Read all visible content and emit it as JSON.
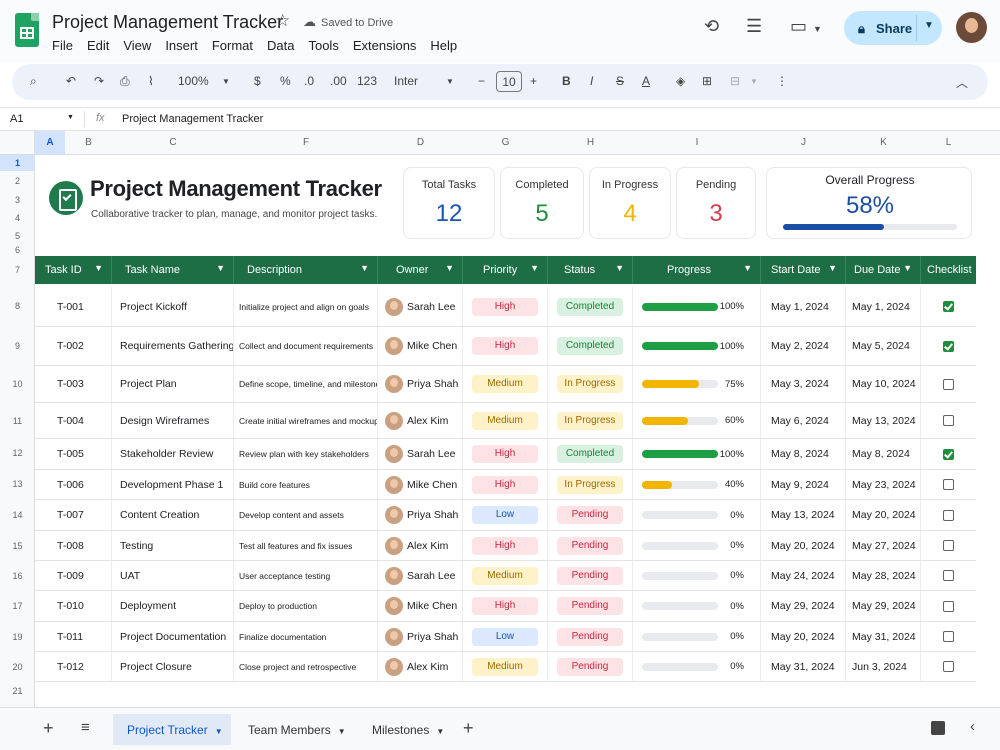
{
  "app": {
    "doc_title": "Project Management Tracker",
    "saved_status": "Saved to Drive",
    "menus": [
      "File",
      "Edit",
      "View",
      "Insert",
      "Format",
      "Data",
      "Tools",
      "Extensions",
      "Help"
    ],
    "share_label": "Share"
  },
  "toolbar": {
    "zoom": "100%",
    "currency": "$",
    "percent": "%",
    "dec_dec": ".0",
    "dec_inc": ".00",
    "number_fmt": "123",
    "font": "Inter",
    "font_size": "10",
    "minus": "−",
    "plus": "+",
    "bold": "B",
    "italic": "I",
    "strike": "S",
    "text_color": "A"
  },
  "formula_bar": {
    "cell_ref": "A1",
    "fx": "fx",
    "value": "Project Management Tracker"
  },
  "columns": [
    "A",
    "B",
    "C",
    "F",
    "D",
    "G",
    "H",
    "I",
    "J",
    "K",
    "L"
  ],
  "row_numbers": [
    "1",
    "2",
    "3",
    "4",
    "5",
    "6",
    "7",
    "8",
    "9",
    "10",
    "11",
    "12",
    "13",
    "14",
    "15",
    "16",
    "17",
    "19",
    "20",
    "21"
  ],
  "header": {
    "title": "Project Management Tracker",
    "subtitle": "Collaborative tracker to plan, manage, and monitor project tasks."
  },
  "summary": {
    "total": {
      "label": "Total Tasks",
      "value": "12",
      "color": "#1a56b5"
    },
    "completed": {
      "label": "Completed",
      "value": "5",
      "color": "#1e8e3e"
    },
    "in_progress": {
      "label": "In Progress",
      "value": "4",
      "color": "#f2b600"
    },
    "pending": {
      "label": "Pending",
      "value": "3",
      "color": "#d93b4a"
    },
    "overall": {
      "label": "Overall Progress",
      "value": "58%",
      "fraction": 0.58
    }
  },
  "table": {
    "headers": [
      "Task ID",
      "Task Name",
      "Description",
      "Owner",
      "Priority",
      "Status",
      "Progress",
      "Start Date",
      "Due Date",
      "Checklist"
    ],
    "rows": [
      {
        "id": "T-001",
        "name": "Project Kickoff",
        "desc": "Initialize project and align on goals",
        "owner": "Sarah Lee",
        "priority": "High",
        "status": "Completed",
        "progress": "100%",
        "pct": 100,
        "start": "May 1, 2024",
        "due": "May 1, 2024",
        "checked": true
      },
      {
        "id": "T-002",
        "name": "Requirements Gathering",
        "desc": "Collect and document requirements",
        "owner": "Mike Chen",
        "priority": "High",
        "status": "Completed",
        "progress": "100%",
        "pct": 100,
        "start": "May 2, 2024",
        "due": "May 5, 2024",
        "checked": true
      },
      {
        "id": "T-003",
        "name": "Project Plan",
        "desc": "Define scope, timeline, and milestones",
        "owner": "Priya Shah",
        "priority": "Medium",
        "status": "In Progress",
        "progress": "75%",
        "pct": 75,
        "start": "May 3, 2024",
        "due": "May 10, 2024",
        "checked": false
      },
      {
        "id": "T-004",
        "name": "Design Wireframes",
        "desc": "Create initial wireframes and mockups",
        "owner": "Alex Kim",
        "priority": "Medium",
        "status": "In Progress",
        "progress": "60%",
        "pct": 60,
        "start": "May 6, 2024",
        "due": "May 13, 2024",
        "checked": false
      },
      {
        "id": "T-005",
        "name": "Stakeholder Review",
        "desc": "Review plan with key stakeholders",
        "owner": "Sarah Lee",
        "priority": "High",
        "status": "Completed",
        "progress": "100%",
        "pct": 100,
        "start": "May 8, 2024",
        "due": "May 8, 2024",
        "checked": true
      },
      {
        "id": "T-006",
        "name": "Development Phase 1",
        "desc": "Build core features",
        "owner": "Mike Chen",
        "priority": "High",
        "status": "In Progress",
        "progress": "40%",
        "pct": 40,
        "start": "May 9, 2024",
        "due": "May 23, 2024",
        "checked": false
      },
      {
        "id": "T-007",
        "name": "Content Creation",
        "desc": "Develop content and assets",
        "owner": "Priya Shah",
        "priority": "Low",
        "status": "Pending",
        "progress": "0%",
        "pct": 0,
        "start": "May 13, 2024",
        "due": "May 20, 2024",
        "checked": false
      },
      {
        "id": "T-008",
        "name": "Testing",
        "desc": "Test all features and fix issues",
        "owner": "Alex Kim",
        "priority": "High",
        "status": "Pending",
        "progress": "0%",
        "pct": 0,
        "start": "May 20, 2024",
        "due": "May 27, 2024",
        "checked": false
      },
      {
        "id": "T-009",
        "name": "UAT",
        "desc": "User acceptance testing",
        "owner": "Sarah Lee",
        "priority": "Medium",
        "status": "Pending",
        "progress": "0%",
        "pct": 0,
        "start": "May 24, 2024",
        "due": "May 28, 2024",
        "checked": false
      },
      {
        "id": "T-010",
        "name": "Deployment",
        "desc": "Deploy to production",
        "owner": "Mike Chen",
        "priority": "High",
        "status": "Pending",
        "progress": "0%",
        "pct": 0,
        "start": "May 29, 2024",
        "due": "May 29, 2024",
        "checked": false
      },
      {
        "id": "T-011",
        "name": "Project Documentation",
        "desc": "Finalize documentation",
        "owner": "Priya Shah",
        "priority": "Low",
        "status": "Pending",
        "progress": "0%",
        "pct": 0,
        "start": "May 20, 2024",
        "due": "May 31, 2024",
        "checked": false
      },
      {
        "id": "T-012",
        "name": "Project Closure",
        "desc": "Close project and retrospective",
        "owner": "Alex Kim",
        "priority": "Medium",
        "status": "Pending",
        "progress": "0%",
        "pct": 0,
        "start": "May 31, 2024",
        "due": "Jun 3, 2024",
        "checked": false
      }
    ]
  },
  "colors": {
    "header_green": "#1e6e45",
    "high_bg": "#fde3e6",
    "high_fg": "#c5283d",
    "medium_bg": "#fff2c9",
    "medium_fg": "#9a6a00",
    "low_bg": "#dce8fd",
    "low_fg": "#1a56b5",
    "completed_bg": "#d9f1e0",
    "completed_fg": "#1e7d3a",
    "inprogress_bg": "#fff2c9",
    "inprogress_fg": "#9a6a00",
    "pending_bg": "#fde3e6",
    "pending_fg": "#c5283d",
    "bar_green": "#1e9e45",
    "bar_yellow": "#f2b600"
  },
  "sheets": {
    "add": "+",
    "active": "Project Tracker",
    "tab2": "Team Members",
    "tab3": "Milestones"
  }
}
